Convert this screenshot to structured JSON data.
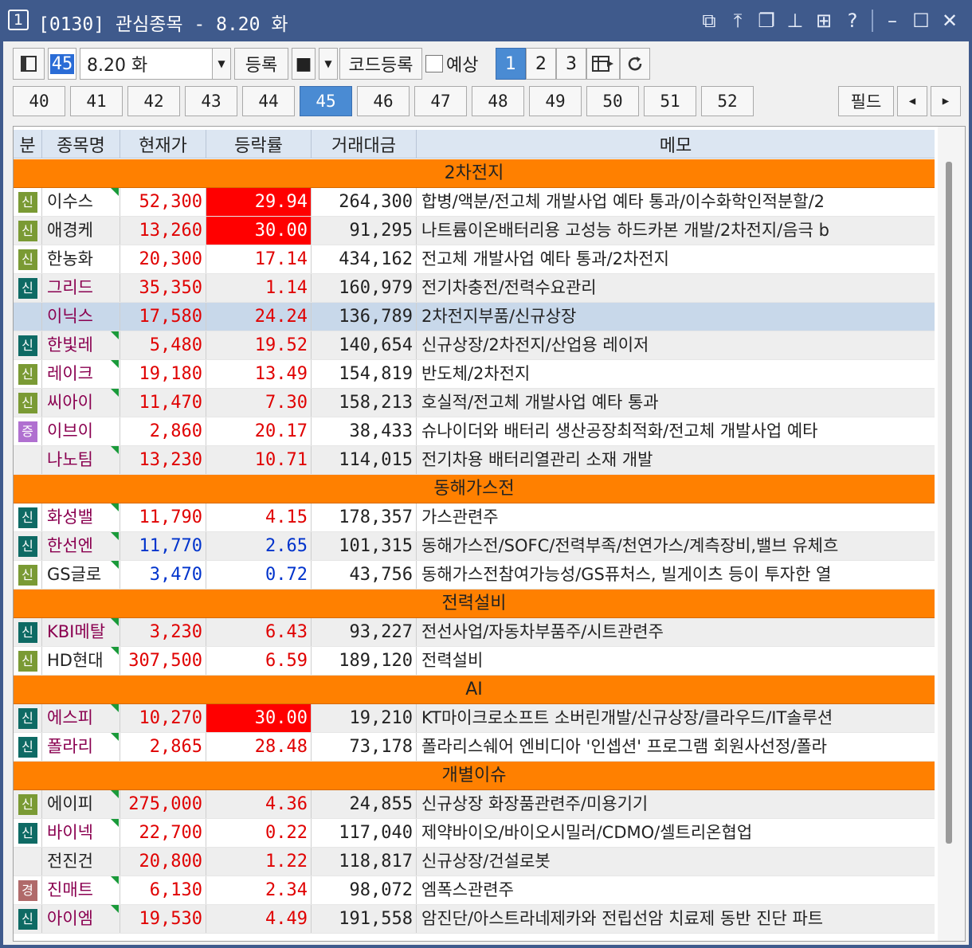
{
  "window": {
    "number": "1",
    "title": "[0130] 관심종목 - 8.20 화"
  },
  "titlebar_icons": [
    "link-window-icon",
    "pin-top-icon",
    "cascade-window-icon",
    "pushpin-icon",
    "grid-layout-icon",
    "help-icon",
    "minimize-icon",
    "maximize-icon",
    "close-icon"
  ],
  "toolbar": {
    "group_number": "45",
    "date_combo": "8.20 화",
    "register_label": "등록",
    "stop_label": "■",
    "code_register_label": "코드등록",
    "forecast_label": "예상",
    "page_buttons": [
      "1",
      "2",
      "3"
    ]
  },
  "tabs": [
    "40",
    "41",
    "42",
    "43",
    "44",
    "45",
    "46",
    "47",
    "48",
    "49",
    "50",
    "51",
    "52"
  ],
  "active_tab": "45",
  "field_button": "필드",
  "columns": {
    "category": "분",
    "name": "종목명",
    "price": "현재가",
    "rate": "등락률",
    "volume": "거래대금",
    "memo": "메모"
  },
  "colors": {
    "up": "#e00000",
    "down": "#0033cc",
    "group_bg": "#ff8000",
    "limit_up_bg": "#ff0000",
    "badge_green": "#7a9a34",
    "badge_teal": "#0e6a64",
    "badge_purple": "#b070d0",
    "badge_rose": "#b06a6a"
  },
  "rows": [
    {
      "type": "group",
      "title": "2차전지"
    },
    {
      "type": "stock",
      "badge": "신",
      "badge_color": "green",
      "name": "이수스",
      "price": "52,300",
      "rate": "29.94",
      "volume": "264,300",
      "memo": "합병/액분/전고체 개발사업 예타 통과/이수화학인적분할/2",
      "dir": "up",
      "hit": true,
      "flag": true,
      "name_color": "#222"
    },
    {
      "type": "stock",
      "badge": "신",
      "badge_color": "green",
      "name": "애경케",
      "price": "13,260",
      "rate": "30.00",
      "volume": "91,295",
      "memo": "나트륨이온배터리용 고성능 하드카본 개발/2차전지/음극 b",
      "dir": "up",
      "hit": true,
      "flag": false,
      "name_color": "#222"
    },
    {
      "type": "stock",
      "badge": "신",
      "badge_color": "green",
      "name": "한농화",
      "price": "20,300",
      "rate": "17.14",
      "volume": "434,162",
      "memo": "전고체 개발사업 예타 통과/2차전지",
      "dir": "up",
      "hit": false,
      "flag": false,
      "name_color": "#222"
    },
    {
      "type": "stock",
      "badge": "신",
      "badge_color": "teal",
      "name": "그리드",
      "price": "35,350",
      "rate": "1.14",
      "volume": "160,979",
      "memo": "전기차충전/전력수요관리",
      "dir": "up",
      "hit": false,
      "flag": false,
      "name_color": "#8a0050"
    },
    {
      "type": "stock",
      "badge": "",
      "badge_color": "",
      "name": "이닉스",
      "price": "17,580",
      "rate": "24.24",
      "volume": "136,789",
      "memo": "2차전지부품/신규상장",
      "dir": "up",
      "hit": false,
      "flag": false,
      "name_color": "#8a0050",
      "selected": true
    },
    {
      "type": "stock",
      "badge": "신",
      "badge_color": "teal",
      "name": "한빛레",
      "price": "5,480",
      "rate": "19.52",
      "volume": "140,654",
      "memo": "신규상장/2차전지/산업용 레이저",
      "dir": "up",
      "hit": false,
      "flag": true,
      "name_color": "#8a0050"
    },
    {
      "type": "stock",
      "badge": "신",
      "badge_color": "green",
      "name": "레이크",
      "price": "19,180",
      "rate": "13.49",
      "volume": "154,819",
      "memo": "반도체/2차전지",
      "dir": "up",
      "hit": false,
      "flag": true,
      "name_color": "#8a0050"
    },
    {
      "type": "stock",
      "badge": "신",
      "badge_color": "green",
      "name": "씨아이",
      "price": "11,470",
      "rate": "7.30",
      "volume": "158,213",
      "memo": "호실적/전고체 개발사업 예타 통과",
      "dir": "up",
      "hit": false,
      "flag": true,
      "name_color": "#8a0050"
    },
    {
      "type": "stock",
      "badge": "증",
      "badge_color": "purple",
      "name": "이브이",
      "price": "2,860",
      "rate": "20.17",
      "volume": "38,433",
      "memo": "슈나이더와 배터리 생산공장최적화/전고체 개발사업 예타",
      "dir": "up",
      "hit": false,
      "flag": false,
      "name_color": "#8a0050"
    },
    {
      "type": "stock",
      "badge": "",
      "badge_color": "",
      "name": "나노팀",
      "price": "13,230",
      "rate": "10.71",
      "volume": "114,015",
      "memo": "전기차용 배터리열관리 소재 개발",
      "dir": "up",
      "hit": false,
      "flag": true,
      "name_color": "#8a0050"
    },
    {
      "type": "group",
      "title": "동해가스전"
    },
    {
      "type": "stock",
      "badge": "신",
      "badge_color": "teal",
      "name": "화성밸",
      "price": "11,790",
      "rate": "4.15",
      "volume": "178,357",
      "memo": "가스관련주",
      "dir": "up",
      "hit": false,
      "flag": true,
      "name_color": "#8a0050"
    },
    {
      "type": "stock",
      "badge": "신",
      "badge_color": "teal",
      "name": "한선엔",
      "price": "11,770",
      "rate": "2.65",
      "volume": "101,315",
      "memo": "동해가스전/SOFC/전력부족/천연가스/계측장비,밸브 유체흐",
      "dir": "down",
      "hit": false,
      "flag": true,
      "name_color": "#8a0050"
    },
    {
      "type": "stock",
      "badge": "신",
      "badge_color": "green",
      "name": "GS글로",
      "price": "3,470",
      "rate": "0.72",
      "volume": "43,756",
      "memo": "동해가스전참여가능성/GS퓨처스, 빌게이츠 등이 투자한 열",
      "dir": "down",
      "hit": false,
      "flag": true,
      "name_color": "#222"
    },
    {
      "type": "group",
      "title": "전력설비"
    },
    {
      "type": "stock",
      "badge": "신",
      "badge_color": "teal",
      "name": "KBI메탈",
      "price": "3,230",
      "rate": "6.43",
      "volume": "93,227",
      "memo": "전선사업/자동차부품주/시트관련주",
      "dir": "up",
      "hit": false,
      "flag": true,
      "name_color": "#8a0050"
    },
    {
      "type": "stock",
      "badge": "신",
      "badge_color": "green",
      "name": "HD현대",
      "price": "307,500",
      "rate": "6.59",
      "volume": "189,120",
      "memo": "전력설비",
      "dir": "up",
      "hit": false,
      "flag": true,
      "name_color": "#222"
    },
    {
      "type": "group",
      "title": "AI"
    },
    {
      "type": "stock",
      "badge": "신",
      "badge_color": "teal",
      "name": "에스피",
      "price": "10,270",
      "rate": "30.00",
      "volume": "19,210",
      "memo": "KT마이크로소프트 소버린개발/신규상장/클라우드/IT솔루션",
      "dir": "up",
      "hit": true,
      "flag": true,
      "name_color": "#8a0050"
    },
    {
      "type": "stock",
      "badge": "신",
      "badge_color": "teal",
      "name": "폴라리",
      "price": "2,865",
      "rate": "28.48",
      "volume": "73,178",
      "memo": "폴라리스쉐어 엔비디아 '인셉션' 프로그램 회원사선정/폴라",
      "dir": "up",
      "hit": false,
      "flag": true,
      "name_color": "#8a0050"
    },
    {
      "type": "group",
      "title": "개별이슈"
    },
    {
      "type": "stock",
      "badge": "신",
      "badge_color": "green",
      "name": "에이피",
      "price": "275,000",
      "rate": "4.36",
      "volume": "24,855",
      "memo": "신규상장 화장품관련주/미용기기",
      "dir": "up",
      "hit": false,
      "flag": true,
      "name_color": "#222"
    },
    {
      "type": "stock",
      "badge": "신",
      "badge_color": "teal",
      "name": "바이넥",
      "price": "22,700",
      "rate": "0.22",
      "volume": "117,040",
      "memo": "제약바이오/바이오시밀러/CDMO/셀트리온협업",
      "dir": "up",
      "hit": false,
      "flag": true,
      "name_color": "#8a0050"
    },
    {
      "type": "stock",
      "badge": "",
      "badge_color": "",
      "name": "전진건",
      "price": "20,800",
      "rate": "1.22",
      "volume": "118,817",
      "memo": "신규상장/건설로봇",
      "dir": "up",
      "hit": false,
      "flag": false,
      "name_color": "#222"
    },
    {
      "type": "stock",
      "badge": "경",
      "badge_color": "rose",
      "name": "진매트",
      "price": "6,130",
      "rate": "2.34",
      "volume": "98,072",
      "memo": "엠폭스관련주",
      "dir": "up",
      "hit": false,
      "flag": true,
      "name_color": "#8a0050"
    },
    {
      "type": "stock",
      "badge": "신",
      "badge_color": "teal",
      "name": "아이엠",
      "price": "19,530",
      "rate": "4.49",
      "volume": "191,558",
      "memo": "암진단/아스트라네제카와 전립선암 치료제 동반 진단 파트",
      "dir": "up",
      "hit": false,
      "flag": true,
      "name_color": "#8a0050"
    }
  ]
}
